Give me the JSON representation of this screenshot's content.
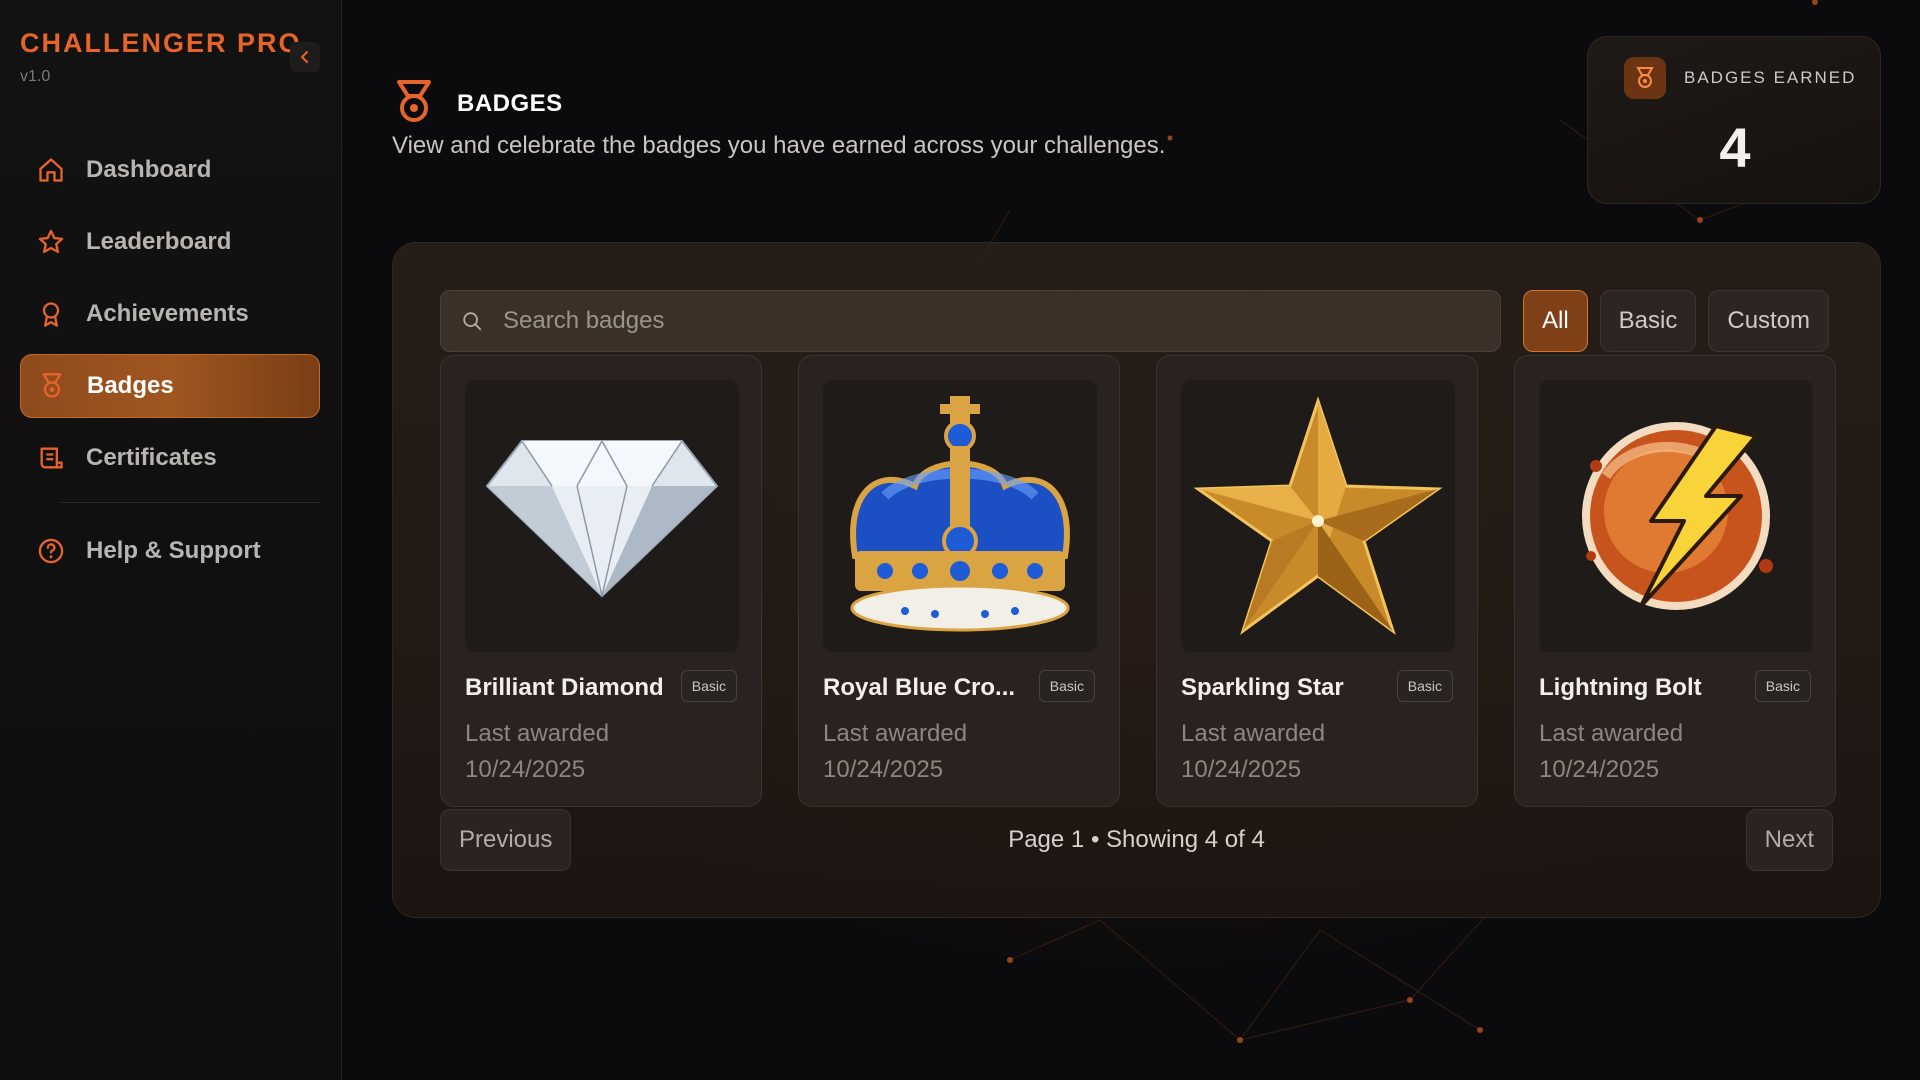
{
  "app": {
    "name": "CHALLENGER PRO",
    "version": "v1.0"
  },
  "sidebar": {
    "items": [
      {
        "label": "Dashboard",
        "icon": "home-icon",
        "active": false
      },
      {
        "label": "Leaderboard",
        "icon": "star-icon",
        "active": false
      },
      {
        "label": "Achievements",
        "icon": "award-ribbon-icon",
        "active": false
      },
      {
        "label": "Badges",
        "icon": "medal-icon",
        "active": true
      },
      {
        "label": "Certificates",
        "icon": "scroll-icon",
        "active": false
      }
    ],
    "support": {
      "label": "Help & Support",
      "icon": "help-circle-icon"
    }
  },
  "header": {
    "title": "BADGES",
    "subtitle": "View and celebrate the badges you have earned across your challenges."
  },
  "stat": {
    "label": "BADGES EARNED",
    "value": "4"
  },
  "search": {
    "placeholder": "Search badges"
  },
  "filters": [
    {
      "label": "All",
      "active": true
    },
    {
      "label": "Basic",
      "active": false
    },
    {
      "label": "Custom",
      "active": false
    }
  ],
  "badges": [
    {
      "name": "Brilliant Diamond",
      "tag": "Basic",
      "meta_label": "Last awarded",
      "date": "10/24/2025",
      "image": "diamond-image"
    },
    {
      "name": "Royal Blue Cro...",
      "tag": "Basic",
      "meta_label": "Last awarded",
      "date": "10/24/2025",
      "image": "crown-image"
    },
    {
      "name": "Sparkling Star",
      "tag": "Basic",
      "meta_label": "Last awarded",
      "date": "10/24/2025",
      "image": "star-image"
    },
    {
      "name": "Lightning Bolt",
      "tag": "Basic",
      "meta_label": "Last awarded",
      "date": "10/24/2025",
      "image": "lightning-image"
    }
  ],
  "pagination": {
    "previous": "Previous",
    "info": "Page 1 • Showing 4 of 4",
    "next": "Next"
  },
  "colors": {
    "accent": "#e5642a",
    "active_bg": "#8f4a1d",
    "background": "#0b0b0d"
  }
}
